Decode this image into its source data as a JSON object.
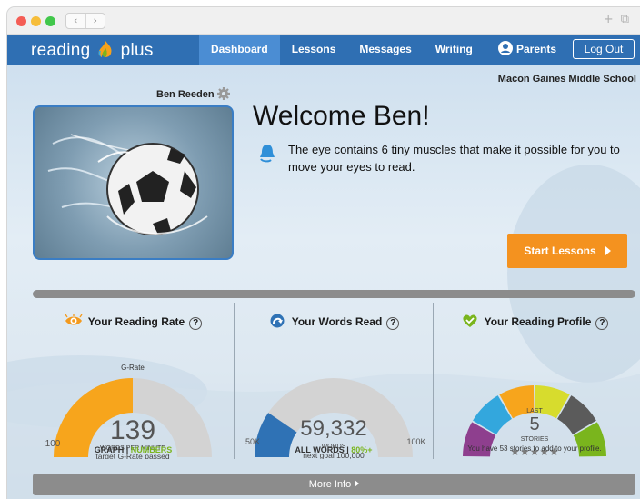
{
  "browser": {
    "back_glyph": "‹",
    "forward_glyph": "›",
    "plus_glyph": "+",
    "tabs_glyph": "⧉"
  },
  "nav": {
    "logo_left": "reading",
    "logo_right": "plus",
    "links": [
      "Dashboard",
      "Lessons",
      "Messages",
      "Writing"
    ],
    "active": "Dashboard",
    "parents_label": "Parents",
    "logout_label": "Log Out"
  },
  "header": {
    "school": "Macon Gaines Middle School",
    "username": "Ben Reeden"
  },
  "welcome": {
    "title": "Welcome Ben!",
    "fact": "The eye contains 6 tiny muscles that make it possible for you to move your eyes to read.",
    "start_label": "Start Lessons"
  },
  "reading_rate": {
    "title": "Your Reading Rate",
    "help": "?",
    "top_label": "G-Rate",
    "left_label": "100",
    "value": "139",
    "unit": "WORDS PER MINUTE",
    "sub": "target G-Rate passed",
    "toggle_graph": "GRAPH",
    "toggle_sep": " | ",
    "toggle_numbers": "NUMBERS",
    "fill_fraction": 0.5,
    "colors": {
      "fill": "#f7a51c",
      "track": "#d3d3d3",
      "link": "#7ab51d"
    }
  },
  "words_read": {
    "title": "Your Words Read",
    "help": "?",
    "left_label": "50K",
    "right_label": "100K",
    "value": "59,332",
    "unit": "WORDS",
    "sub": "next goal 100,000",
    "toggle_all": "ALL WORDS",
    "toggle_sep": " | ",
    "toggle_pct": "80%+",
    "fill_fraction": 0.19,
    "colors": {
      "fill": "#2f72b5",
      "track": "#d3d3d3",
      "link": "#7ab51d"
    }
  },
  "reading_profile": {
    "title": "Your Reading Profile",
    "help": "?",
    "top_label": "LAST",
    "value": "5",
    "unit": "STORIES",
    "stars": "★★★★★",
    "note": "You have 53 stories to add to your profile.",
    "segment_colors": [
      "#8e3f8e",
      "#33a7dd",
      "#f7a51c",
      "#d7dc2d",
      "#5b5b5b",
      "#7ab51d"
    ]
  },
  "more_info": {
    "label": "More Info"
  }
}
